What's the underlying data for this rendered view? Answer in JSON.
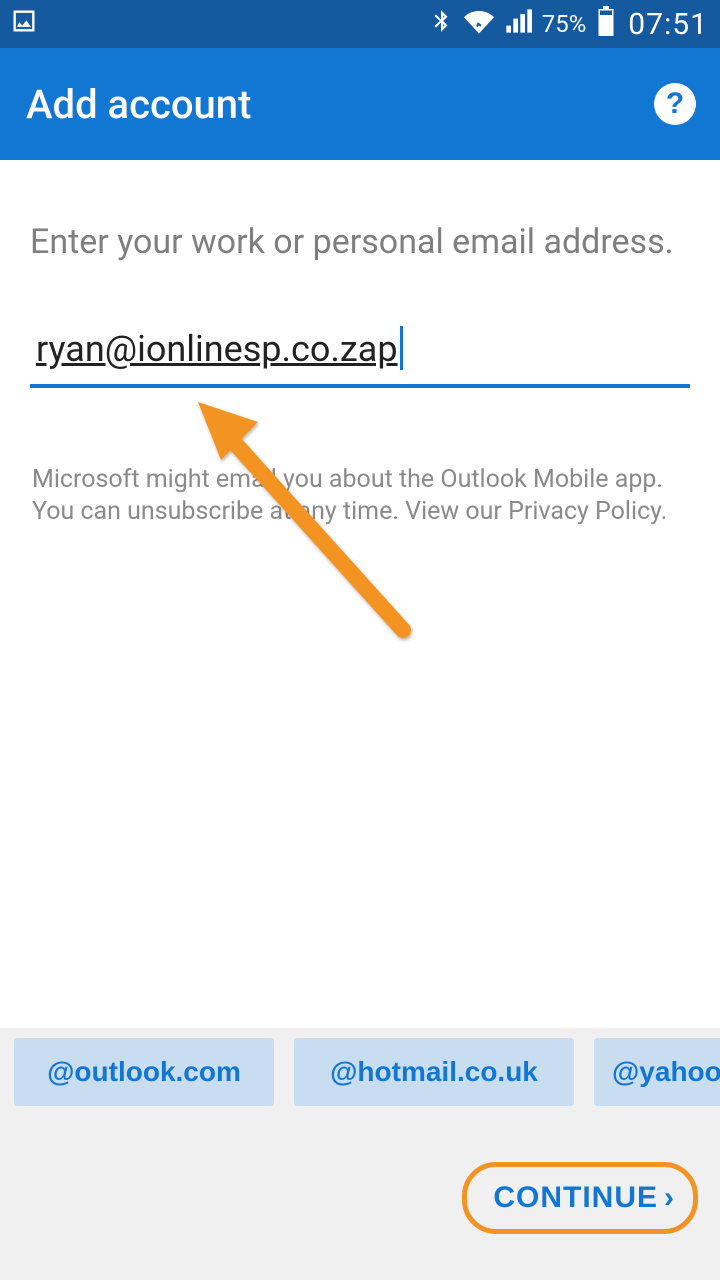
{
  "status": {
    "battery_pct": "75%",
    "time": "07:51"
  },
  "header": {
    "title": "Add account"
  },
  "main": {
    "prompt": "Enter your work or personal email address.",
    "email_value": "ryan@ionlinesp.co.zap",
    "disclaimer": "Microsoft might email you about the Outlook Mobile app. You can unsubscribe at any time. View our Privacy Policy."
  },
  "suggestions": {
    "items": [
      "@outlook.com",
      "@hotmail.co.uk",
      "@yahoo"
    ]
  },
  "footer": {
    "continue_label": "CONTINUE"
  }
}
